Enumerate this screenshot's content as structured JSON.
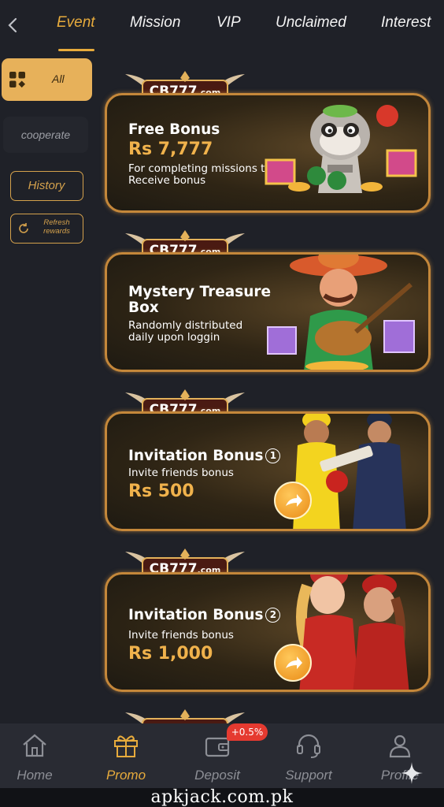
{
  "tabs": [
    {
      "label": "Event",
      "active": true
    },
    {
      "label": "Mission",
      "active": false
    },
    {
      "label": "VIP",
      "active": false
    },
    {
      "label": "Unclaimed",
      "active": false
    },
    {
      "label": "Interest",
      "active": false
    }
  ],
  "sidebar": {
    "all_label": "All",
    "cooperate_label": "cooperate",
    "history_label": "History",
    "refresh_label": "Refresh rewards"
  },
  "cards": [
    {
      "logo_text": "CB777.com",
      "title": "Free Bonus",
      "amount": "Rs 7,777",
      "desc": "For completing missions to Receive bonus",
      "art": "raccoon-with-gifts"
    },
    {
      "logo_text": "CB777.com",
      "title": "Mystery Treasure Box",
      "desc": "Randomly distributed daily upon loggin",
      "art": "mariachi-guitarist"
    },
    {
      "logo_text": "CB777.com",
      "title": "Invitation Bonus",
      "title_num": "1",
      "desc": "Invite friends bonus",
      "amount": "Rs 500",
      "art": "cricket-players"
    },
    {
      "logo_text": "CB777.com",
      "title": "Invitation Bonus",
      "title_num": "2",
      "desc": "Invite friends bonus",
      "amount": "Rs 1,000",
      "art": "aviator-girls"
    }
  ],
  "bottom_nav": [
    {
      "label": "Home",
      "icon": "home-icon",
      "active": false
    },
    {
      "label": "Promo",
      "icon": "gift-icon",
      "active": true
    },
    {
      "label": "Deposit",
      "icon": "wallet-icon",
      "active": false
    },
    {
      "label": "Support",
      "icon": "headset-icon",
      "active": false
    },
    {
      "label": "Profile",
      "icon": "person-icon",
      "active": false
    }
  ],
  "deposit_badge": "+0.5%",
  "watermark": "apkjack.com.pk",
  "colors": {
    "background": "#1f2128",
    "accent": "#e7ab3c",
    "badge": "#e53a30"
  }
}
